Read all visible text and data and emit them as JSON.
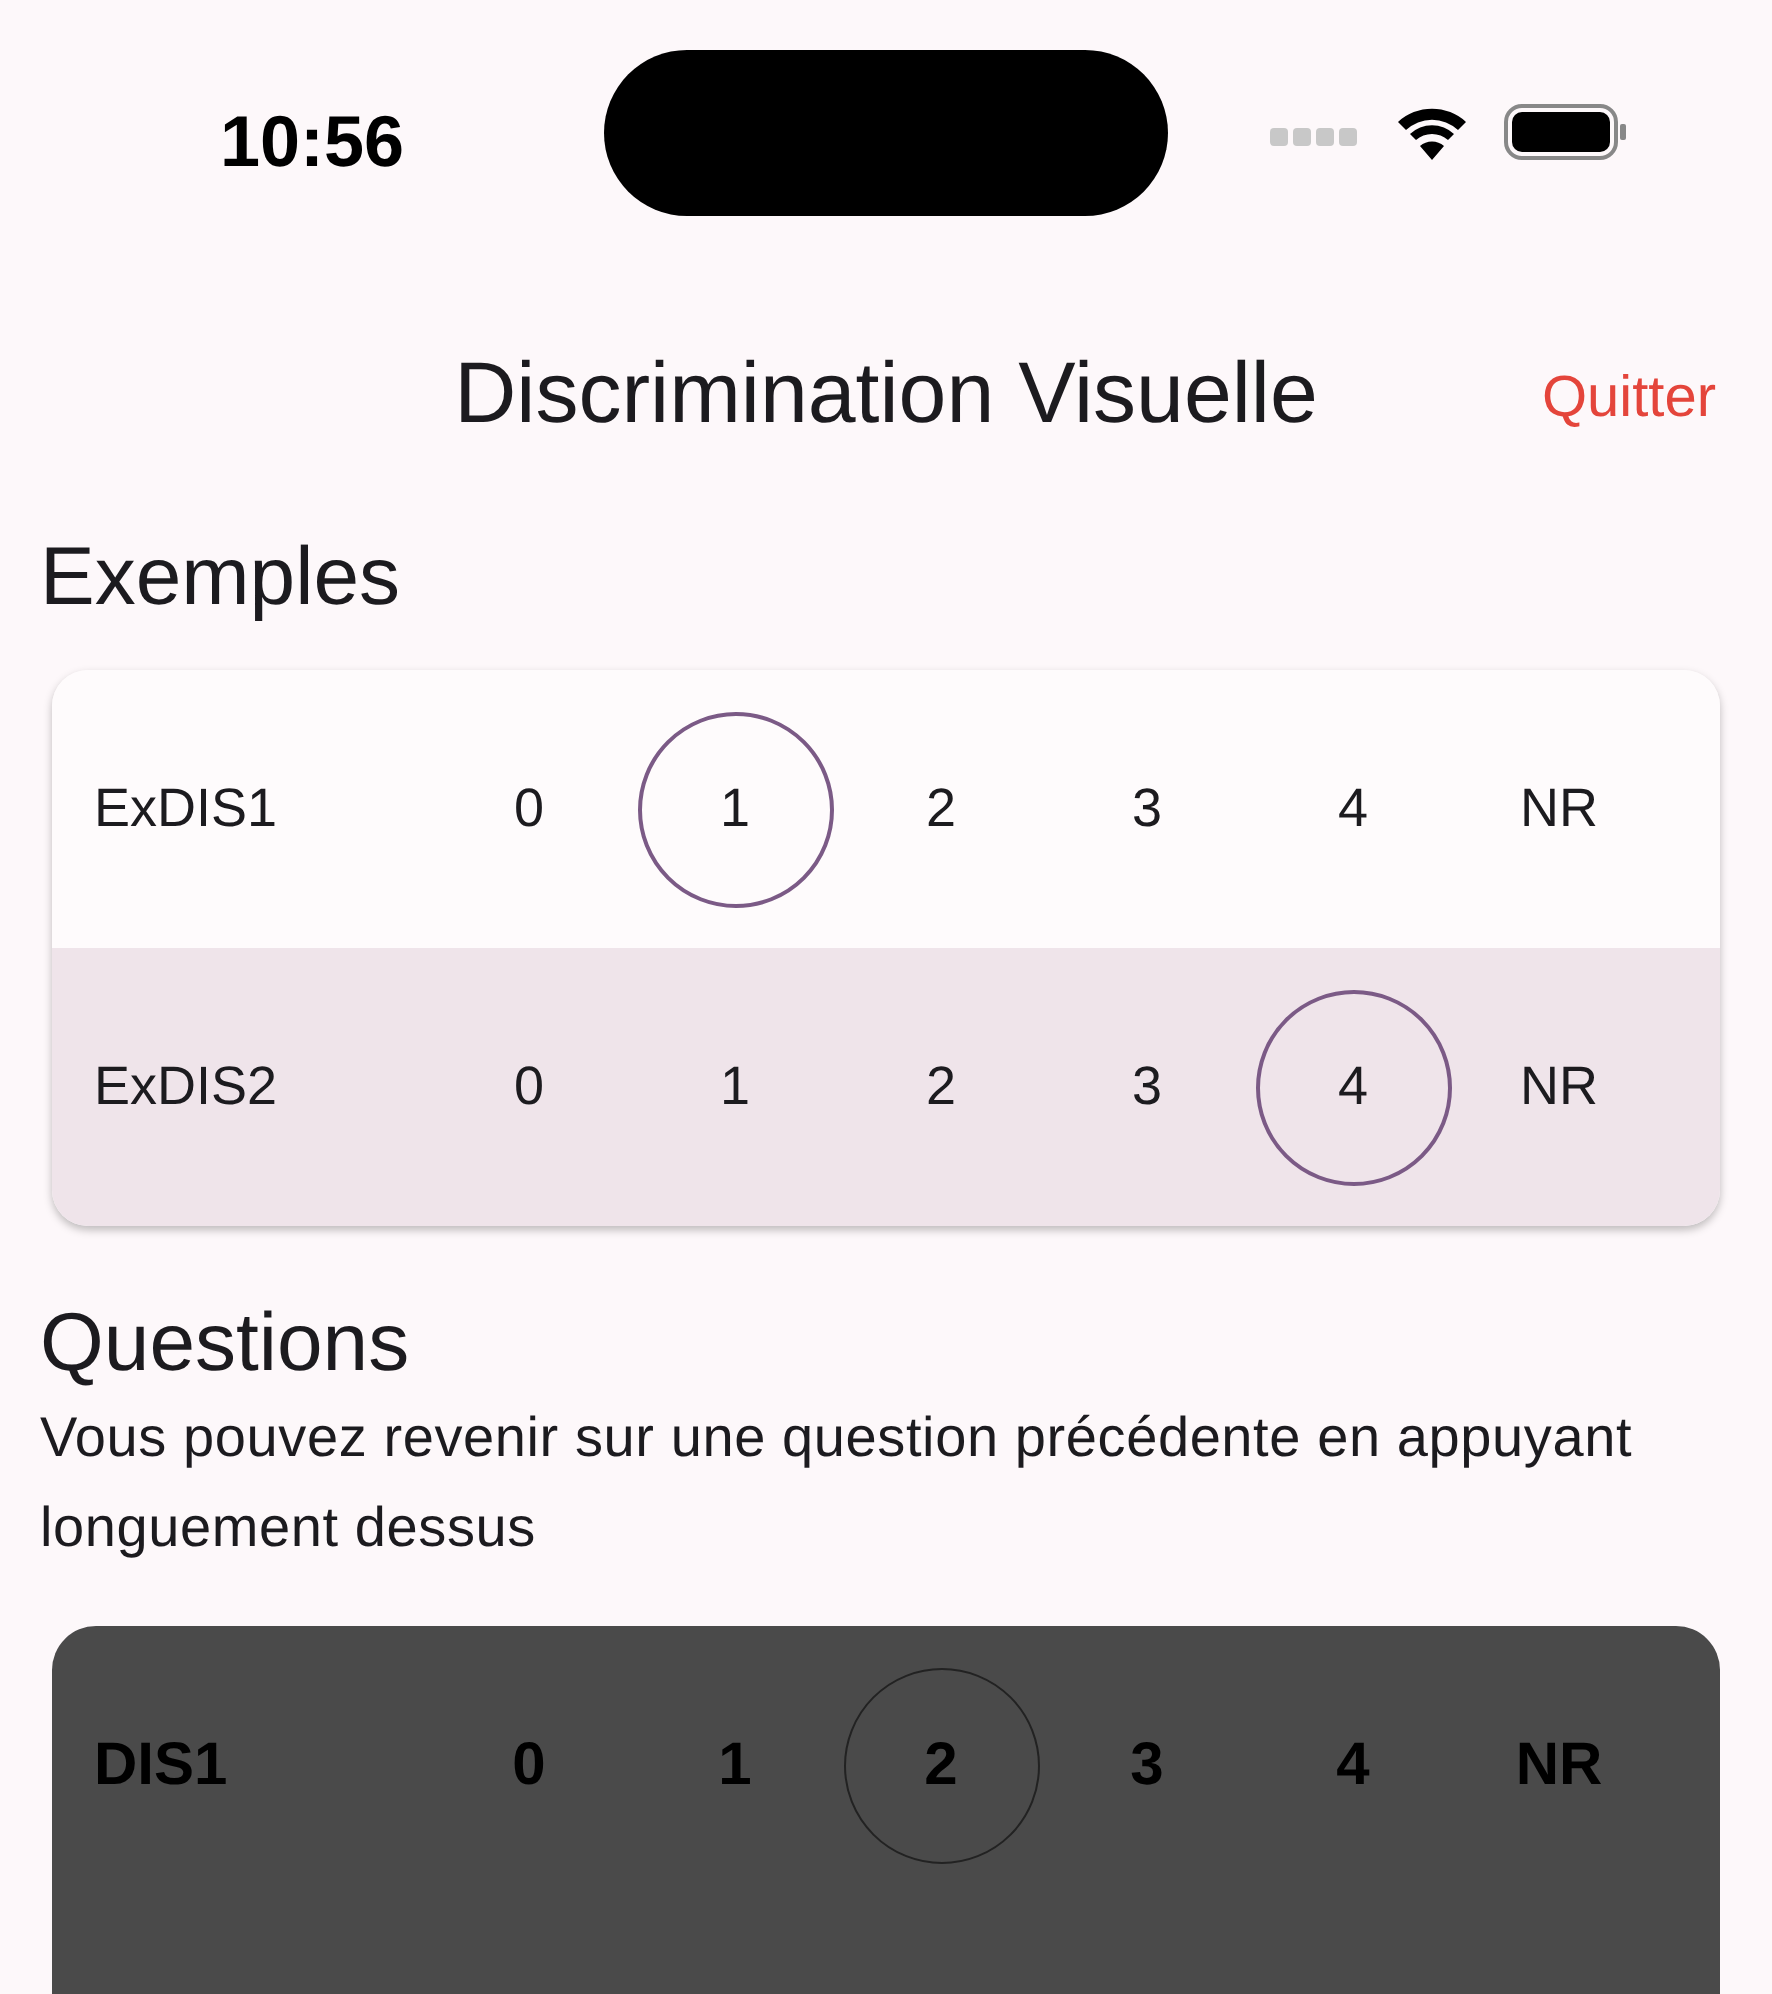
{
  "status_bar": {
    "time": "10:56"
  },
  "header": {
    "title": "Discrimination Visuelle",
    "quit": "Quitter"
  },
  "examples": {
    "title": "Exemples",
    "rows": [
      {
        "label": "ExDIS1",
        "highlighted": false,
        "options": [
          {
            "label": "0",
            "selected": false
          },
          {
            "label": "1",
            "selected": true
          },
          {
            "label": "2",
            "selected": false
          },
          {
            "label": "3",
            "selected": false
          },
          {
            "label": "4",
            "selected": false
          },
          {
            "label": "NR",
            "selected": false
          }
        ]
      },
      {
        "label": "ExDIS2",
        "highlighted": true,
        "options": [
          {
            "label": "0",
            "selected": false
          },
          {
            "label": "1",
            "selected": false
          },
          {
            "label": "2",
            "selected": false
          },
          {
            "label": "3",
            "selected": false
          },
          {
            "label": "4",
            "selected": true
          },
          {
            "label": "NR",
            "selected": false
          }
        ]
      }
    ]
  },
  "questions": {
    "title": "Questions",
    "hint": "Vous pouvez revenir sur une question précédente en appuyant longuement dessus",
    "rows": [
      {
        "label": "DIS1",
        "options": [
          {
            "label": "0",
            "selected": false
          },
          {
            "label": "1",
            "selected": false
          },
          {
            "label": "2",
            "selected": true
          },
          {
            "label": "3",
            "selected": false
          },
          {
            "label": "4",
            "selected": false
          },
          {
            "label": "NR",
            "selected": false
          }
        ]
      }
    ]
  }
}
